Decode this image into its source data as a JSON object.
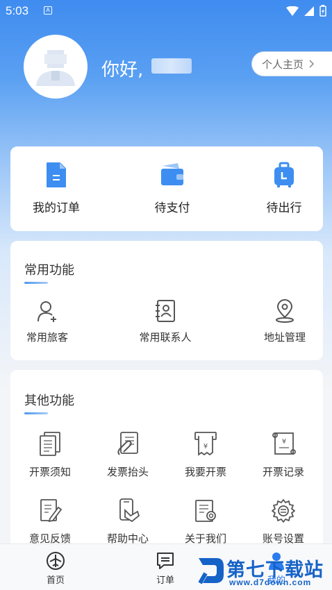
{
  "status_bar": {
    "time": "5:03",
    "notification_icon": "a-badge-icon",
    "notif_letter": "A"
  },
  "profile": {
    "greeting": "你好,",
    "homepage_button": "个人主页"
  },
  "orders": {
    "items": [
      {
        "label": "我的订单",
        "icon": "document-icon",
        "color": "#3d8ef0"
      },
      {
        "label": "待支付",
        "icon": "wallet-icon",
        "color": "#3d8ef0"
      },
      {
        "label": "待出行",
        "icon": "luggage-icon",
        "color": "#3d8ef0"
      }
    ]
  },
  "common_functions": {
    "title": "常用功能",
    "items": [
      {
        "label": "常用旅客",
        "icon": "user-add-icon"
      },
      {
        "label": "常用联系人",
        "icon": "contact-card-icon"
      },
      {
        "label": "地址管理",
        "icon": "location-pin-icon"
      }
    ]
  },
  "other_functions": {
    "title": "其他功能",
    "items": [
      {
        "label": "开票须知",
        "icon": "document-stack-icon"
      },
      {
        "label": "发票抬头",
        "icon": "invoice-clip-icon"
      },
      {
        "label": "我要开票",
        "icon": "receipt-printer-icon"
      },
      {
        "label": "开票记录",
        "icon": "invoice-scroll-icon"
      },
      {
        "label": "意见反馈",
        "icon": "edit-document-icon"
      },
      {
        "label": "帮助中心",
        "icon": "phone-hand-icon"
      },
      {
        "label": "关于我们",
        "icon": "certificate-icon"
      },
      {
        "label": "账号设置",
        "icon": "gear-icon"
      }
    ]
  },
  "tabbar": {
    "tabs": [
      {
        "label": "首页",
        "icon": "airplane-icon"
      },
      {
        "label": "订单",
        "icon": "message-list-icon"
      },
      {
        "label": "我的",
        "icon": "person-icon",
        "active": true
      }
    ]
  },
  "watermark": {
    "title": "第七下载站",
    "url": "www.d7down.com"
  },
  "colors": {
    "accent": "#3d8ef0",
    "watermark": "#1663c7"
  }
}
